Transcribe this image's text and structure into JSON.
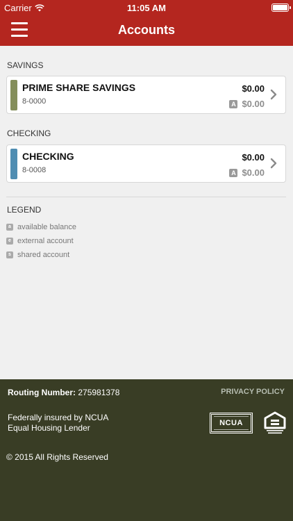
{
  "status_bar": {
    "carrier": "Carrier",
    "time": "11:05 AM"
  },
  "nav": {
    "title": "Accounts",
    "menu_icon": "hamburger-menu-icon"
  },
  "sections": [
    {
      "label": "SAVINGS",
      "accounts": [
        {
          "name": "PRIME SHARE SAVINGS",
          "number": "8-0000",
          "balance": "$0.00",
          "available_badge": "A",
          "available": "$0.00",
          "color": "#848e5b"
        }
      ]
    },
    {
      "label": "CHECKING",
      "accounts": [
        {
          "name": "CHECKING",
          "number": "8-0008",
          "balance": "$0.00",
          "available_badge": "A",
          "available": "$0.00",
          "color": "#4f8db2"
        }
      ]
    }
  ],
  "legend": {
    "title": "LEGEND",
    "items": [
      {
        "badge": "a",
        "label": "available balance"
      },
      {
        "badge": "e",
        "label": "external account"
      },
      {
        "badge": "s",
        "label": "shared account"
      }
    ]
  },
  "footer": {
    "routing_label": "Routing Number:",
    "routing_number": "275981378",
    "privacy": "PRIVACY POLICY",
    "insured_line1": "Federally insured by NCUA",
    "insured_line2": "Equal Housing Lender",
    "copyright": "© 2015 All Rights Reserved",
    "ncua_logo": "NCUA"
  },
  "colors": {
    "brand_red": "#b4261f",
    "footer_bg": "#393d25",
    "page_bg": "#f0f0f0"
  }
}
